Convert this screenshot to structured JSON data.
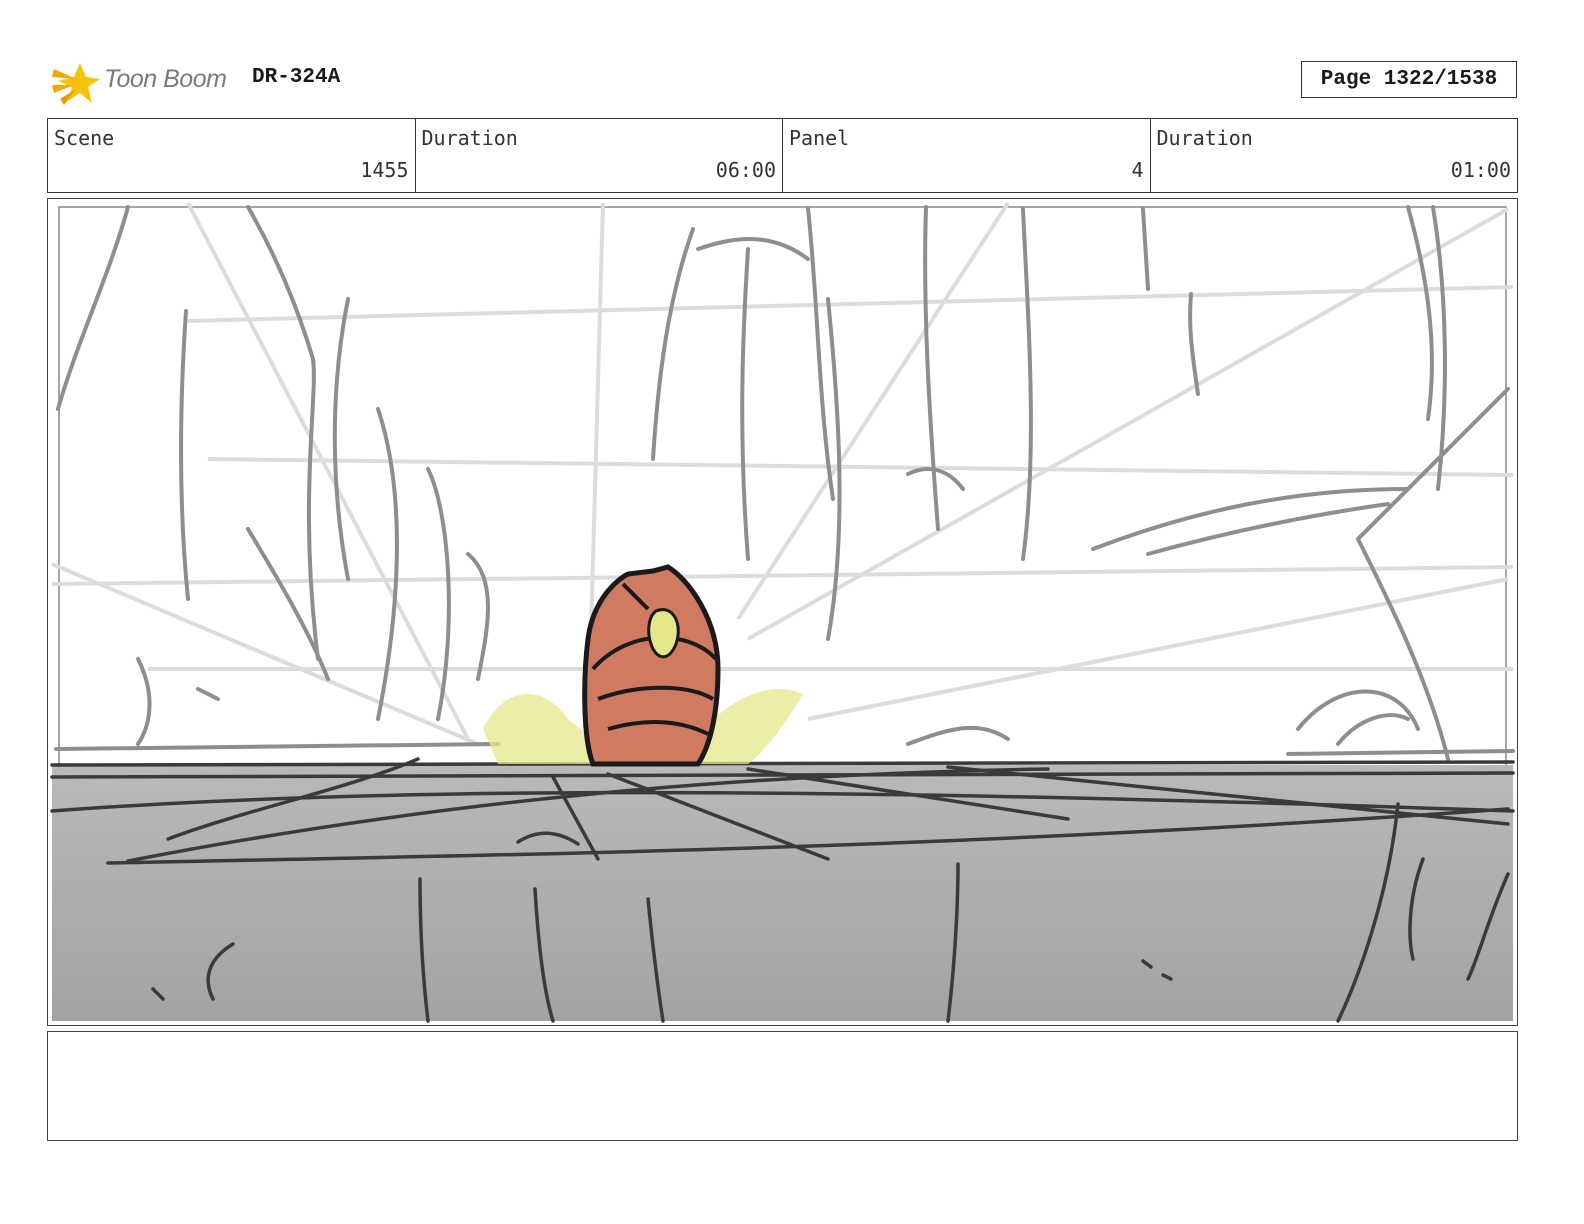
{
  "header": {
    "logo_text": "Toon Boom",
    "logo_icon": "toon-boom-star-icon",
    "project_id": "DR-324A",
    "page_label": "Page 1322/1538"
  },
  "info": {
    "scene_label": "Scene",
    "scene_value": "1455",
    "scene_duration_label": "Duration",
    "scene_duration_value": "06:00",
    "panel_label": "Panel",
    "panel_value": "4",
    "panel_duration_label": "Duration",
    "panel_duration_value": "01:00"
  },
  "panel": {
    "floor_color": "#a9a9ab",
    "character_color": "#d07a62",
    "highlight_color": "#e6e78a"
  },
  "notes": {
    "text": ""
  }
}
